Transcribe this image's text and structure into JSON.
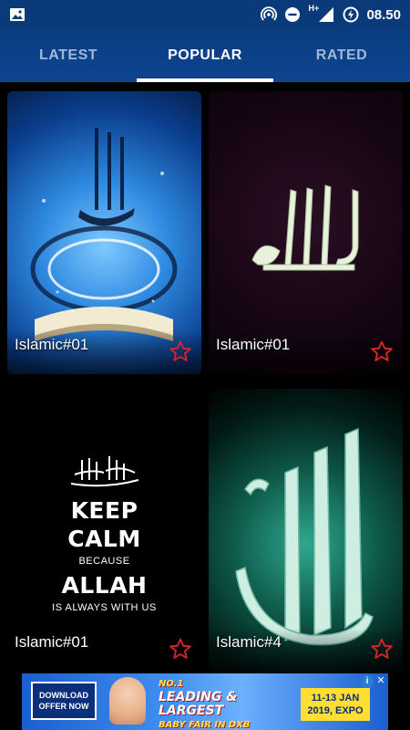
{
  "status_bar": {
    "time": "08.50",
    "network_label": "H+",
    "icons": [
      "image-icon",
      "hotspot-icon",
      "do-not-disturb-icon",
      "signal-icon",
      "battery-charging-icon"
    ]
  },
  "tabs": [
    {
      "label": "LATEST",
      "active": false
    },
    {
      "label": "POPULAR",
      "active": true
    },
    {
      "label": "RATED",
      "active": false
    }
  ],
  "cards": [
    {
      "title": "Islamic#01",
      "favorited": false
    },
    {
      "title": "Islamic#01",
      "favorited": false
    },
    {
      "title": "Islamic#01",
      "favorited": false,
      "poster": {
        "line1": "KEEP",
        "line2": "CALM",
        "line3": "BECAUSE",
        "line4": "ALLAH",
        "line5": "IS ALWAYS WITH US"
      }
    },
    {
      "title": "Islamic#4",
      "favorited": false
    }
  ],
  "ad": {
    "download_line1": "DOWNLOAD",
    "download_line2": "OFFER NOW",
    "headline1": "NO.1",
    "headline2": "LEADING &",
    "headline3": "LARGEST",
    "headline4": "BABY FAIR IN DXB",
    "date_line1": "11-13 JAN",
    "date_line2": "2019, EXPO",
    "info_glyph": "i",
    "close_glyph": "✕"
  },
  "colors": {
    "app_bar": "#0b3c80",
    "tab_indicator": "#ffffff",
    "star_outline": "#d0262a"
  }
}
